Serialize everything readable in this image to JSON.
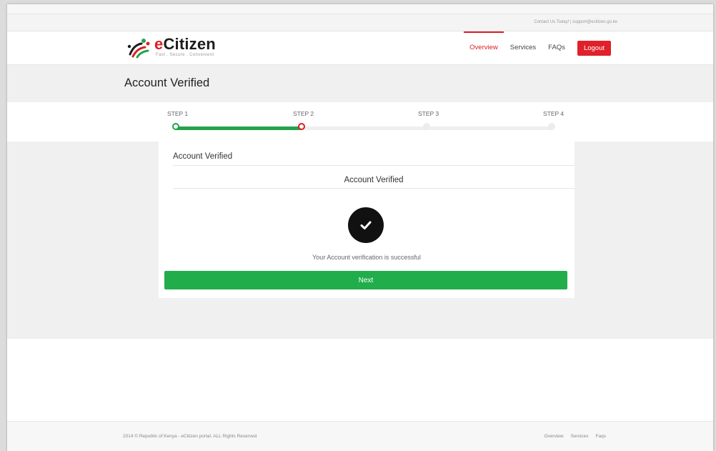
{
  "topbar": {
    "contact_text": "Contact Us Today! | support@ecitizen.go.ke"
  },
  "brand": {
    "name_prefix": "e",
    "name_rest": "Citizen",
    "tagline": "Fast . Secure . Convenient",
    "colors": {
      "red": "#d91f26",
      "green": "#22a34a",
      "dark": "#1c1c1c"
    }
  },
  "nav": {
    "items": [
      {
        "label": "Overview",
        "active": true
      },
      {
        "label": "Services",
        "active": false
      },
      {
        "label": "FAQs",
        "active": false
      }
    ],
    "logout_label": "Logout"
  },
  "page": {
    "title": "Account Verified"
  },
  "steps": {
    "items": [
      {
        "label": "STEP 1",
        "state": "done"
      },
      {
        "label": "STEP 2",
        "state": "current"
      },
      {
        "label": "STEP 3",
        "state": "todo"
      },
      {
        "label": "STEP 4",
        "state": "todo"
      }
    ],
    "progress_fraction": 0.333
  },
  "card": {
    "header": "Account Verified",
    "subtitle": "Account Verified",
    "icon": "check-circle-icon",
    "message": "Your Account verification is successful",
    "next_label": "Next"
  },
  "footer": {
    "copyright": "2014 © Republic of Kenya - eCitizen portal. ALL Rights Reserved",
    "links": [
      "Overview",
      "Services",
      "Faqs"
    ]
  }
}
